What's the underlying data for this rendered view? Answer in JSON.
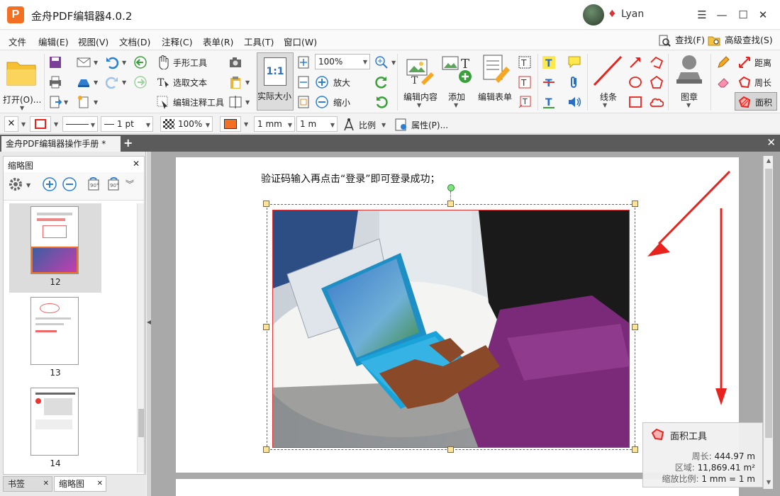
{
  "window": {
    "title": "金舟PDF编辑器4.0.2",
    "user_name": "Lyan",
    "controls": {
      "menu": "☰",
      "minimize": "—",
      "maximize": "☐",
      "close": "✕"
    }
  },
  "menu": {
    "items": [
      "文件",
      "编辑(E)",
      "视图(V)",
      "文档(D)",
      "注释(C)",
      "表单(R)",
      "工具(T)",
      "窗口(W)"
    ],
    "find": "查找(F)",
    "advanced_find": "高级查找(S)"
  },
  "ribbon": {
    "open": "打开(O)...",
    "hand_tool": "手形工具",
    "select_text": "选取文本",
    "edit_annotation": "编辑注释工具",
    "actual_size": "实际大小",
    "actual_size_icon": "1:1",
    "zoom_value": "100%",
    "zoom_in": "放大",
    "zoom_out": "缩小",
    "edit_content": "编辑内容",
    "add": "添加",
    "edit_form": "编辑表单",
    "lines": "线条",
    "stamp": "图章",
    "distance": "距离",
    "perimeter": "周长",
    "area": "面积"
  },
  "format_bar": {
    "line_width": "1 pt",
    "opacity": "100%",
    "scale_from": "1 mm",
    "scale_to": "1 m",
    "ratio": "比例",
    "properties": "属性(P)..."
  },
  "tabs": {
    "document_tab": "金舟PDF编辑器操作手册 *",
    "add": "+",
    "close_all": "✕"
  },
  "sidebar": {
    "title": "缩略图",
    "close": "✕",
    "pages": [
      "12",
      "13",
      "14"
    ],
    "bottom_tabs": [
      "书签",
      "缩略图"
    ]
  },
  "document": {
    "text_line": "验证码输入再点击“登录”即可登录成功；"
  },
  "measure_popup": {
    "title": "面积工具",
    "perimeter_label": "周长:",
    "perimeter_value": "444.97 m",
    "area_label": "区域:",
    "area_value": "11,869.41 m²",
    "scale_label": "缩放比例:",
    "scale_value": "1 mm = 1 m"
  },
  "colors": {
    "accent_orange": "#f36f21",
    "arrow_red": "#e8221c",
    "selection_red": "#dd3333"
  }
}
